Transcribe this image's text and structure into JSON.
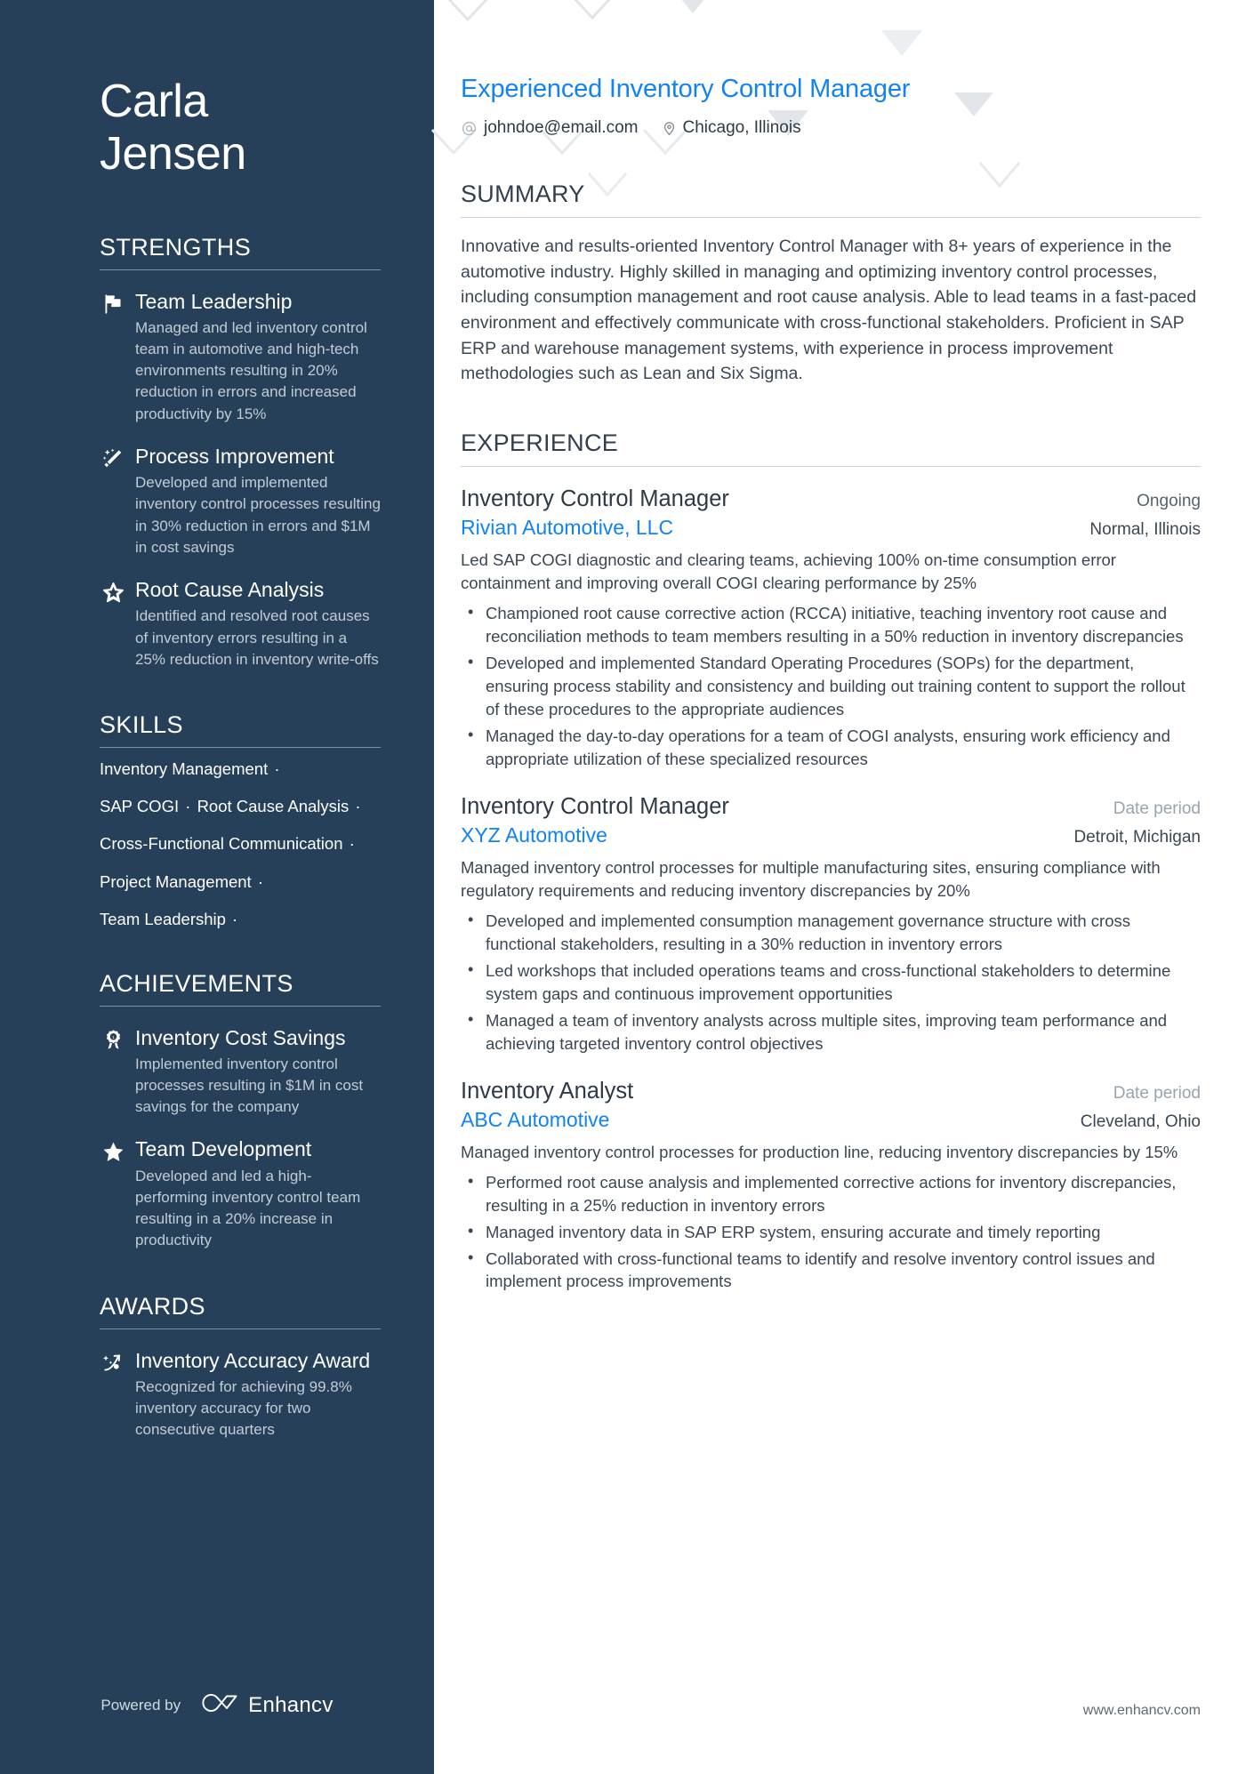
{
  "sidebar": {
    "name_line1": "Carla",
    "name_line2": "Jensen",
    "strengths": {
      "title": "STRENGTHS",
      "items": [
        {
          "icon": "flag-icon",
          "title": "Team Leadership",
          "desc": "Managed and led inventory control team in automotive and high-tech environments resulting in 20% reduction in errors and increased productivity by 15%"
        },
        {
          "icon": "magic-wand-icon",
          "title": "Process Improvement",
          "desc": "Developed and implemented inventory control processes resulting in 30% reduction in errors and $1M in cost savings"
        },
        {
          "icon": "star-outline-icon",
          "title": "Root Cause Analysis",
          "desc": "Identified and resolved root causes of inventory errors resulting in a 25% reduction in inventory write-offs"
        }
      ]
    },
    "skills": {
      "title": "SKILLS",
      "separator": "·",
      "lines": [
        [
          "Inventory Management"
        ],
        [
          "SAP COGI",
          "Root Cause Analysis"
        ],
        [
          "Cross-Functional Communication"
        ],
        [
          "Project Management"
        ],
        [
          "Team Leadership"
        ]
      ]
    },
    "achievements": {
      "title": "ACHIEVEMENTS",
      "items": [
        {
          "icon": "medal-icon",
          "title": "Inventory Cost Savings",
          "desc": "Implemented inventory control processes resulting in $1M in cost savings for the company"
        },
        {
          "icon": "star-filled-icon",
          "title": "Team Development",
          "desc": "Developed and led a high-performing inventory control team resulting in a 20% increase in productivity"
        }
      ]
    },
    "awards": {
      "title": "AWARDS",
      "items": [
        {
          "icon": "rocket-icon",
          "title": "Inventory Accuracy Award",
          "desc": "Recognized for achieving 99.8% inventory accuracy for two consecutive quarters"
        }
      ]
    },
    "footer": {
      "powered_by": "Powered by",
      "brand": "Enhancv"
    }
  },
  "main": {
    "headline": "Experienced Inventory Control Manager",
    "contacts": [
      {
        "icon": "at-icon",
        "text": "johndoe@email.com"
      },
      {
        "icon": "location-pin-icon",
        "text": "Chicago, Illinois"
      }
    ],
    "summary": {
      "title": "SUMMARY",
      "text": "Innovative and results-oriented Inventory Control Manager with 8+ years of experience in the automotive industry. Highly skilled in managing and optimizing inventory control processes, including consumption management and root cause analysis. Able to lead teams in a fast-paced environment and effectively communicate with cross-functional stakeholders. Proficient in SAP ERP and warehouse management systems, with experience in process improvement methodologies such as Lean and Six Sigma."
    },
    "experience": {
      "title": "EXPERIENCE",
      "jobs": [
        {
          "role": "Inventory Control Manager",
          "date": "Ongoing",
          "date_muted": false,
          "company": "Rivian Automotive, LLC",
          "location": "Normal, Illinois",
          "desc": "Led SAP COGI diagnostic and clearing teams, achieving 100% on-time consumption error containment and improving overall COGI clearing performance by 25%",
          "bullets": [
            "Championed root cause corrective action (RCCA) initiative, teaching inventory root cause and reconciliation methods to team members resulting in a 50% reduction in inventory discrepancies",
            "Developed and implemented Standard Operating Procedures (SOPs) for the department, ensuring process stability and consistency and building out training content to support the rollout of these procedures to the appropriate audiences",
            "Managed the day-to-day operations for a team of COGI analysts, ensuring work efficiency and appropriate utilization of these specialized resources"
          ]
        },
        {
          "role": "Inventory Control Manager",
          "date": "Date period",
          "date_muted": true,
          "company": "XYZ Automotive",
          "location": "Detroit, Michigan",
          "desc": "Managed inventory control processes for multiple manufacturing sites, ensuring compliance with regulatory requirements and reducing inventory discrepancies by 20%",
          "bullets": [
            "Developed and implemented consumption management governance structure with cross functional stakeholders, resulting in a 30% reduction in inventory errors",
            "Led workshops that included operations teams and cross-functional stakeholders to determine system gaps and continuous improvement opportunities",
            "Managed a team of inventory analysts across multiple sites, improving team performance and achieving targeted inventory control objectives"
          ]
        },
        {
          "role": "Inventory Analyst",
          "date": "Date period",
          "date_muted": true,
          "company": "ABC Automotive",
          "location": "Cleveland, Ohio",
          "desc": "Managed inventory control processes for production line, reducing inventory discrepancies by 15%",
          "bullets": [
            "Performed root cause analysis and implemented corrective actions for inventory discrepancies, resulting in a 25% reduction in inventory errors",
            "Managed inventory data in SAP ERP system, ensuring accurate and timely reporting",
            "Collaborated with cross-functional teams to identify and resolve inventory control issues and implement process improvements"
          ]
        }
      ]
    },
    "footer_url": "www.enhancv.com"
  },
  "colors": {
    "sidebar_bg": "#254058",
    "accent_blue": "#1183f2",
    "body_text": "#3b4754",
    "muted_text": "#98a4ae"
  }
}
